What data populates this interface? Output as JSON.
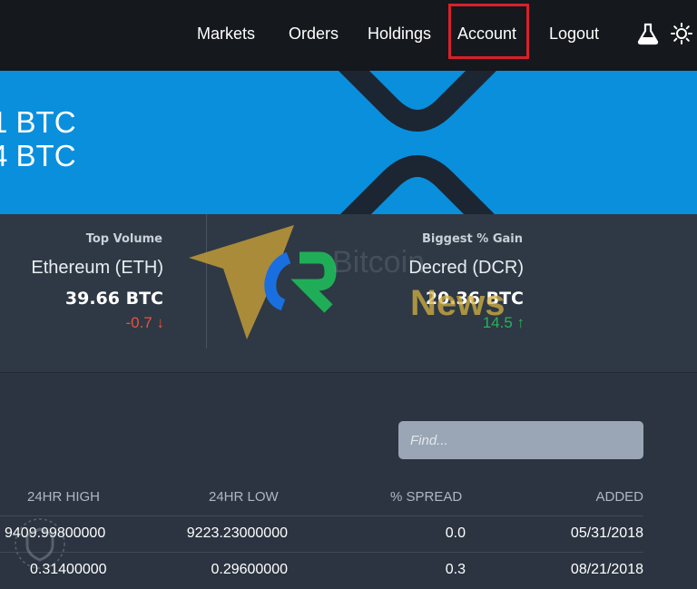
{
  "nav": {
    "items": [
      {
        "label": "Markets"
      },
      {
        "label": "Orders"
      },
      {
        "label": "Holdings"
      },
      {
        "label": "Account"
      },
      {
        "label": "Logout"
      }
    ],
    "icons": [
      "flask-icon",
      "sun-icon"
    ],
    "highlight_color": "#d8202a"
  },
  "banner": {
    "line1": "1 BTC",
    "line2": "4 BTC",
    "color": "#0a8fdc"
  },
  "stats": {
    "top_volume": {
      "label": "Top Volume",
      "name": "Ethereum (ETH)",
      "value": "39.66 BTC",
      "change": "-0.7 ↓"
    },
    "biggest_gain": {
      "label": "Biggest % Gain",
      "name": "Decred (DCR)",
      "value": "20.36 BTC",
      "change": "14.5 ↑"
    }
  },
  "watermark": {
    "text1": "Bitcoin",
    "text2": "News"
  },
  "market": {
    "search_placeholder": "Find...",
    "columns": [
      "24HR HIGH",
      "24HR LOW",
      "% SPREAD",
      "ADDED"
    ],
    "rows": [
      {
        "high": "9409.99800000",
        "low": "9223.23000000",
        "spread": "0.0",
        "added": "05/31/2018"
      },
      {
        "high": "0.31400000",
        "low": "0.29600000",
        "spread": "0.3",
        "added": "08/21/2018"
      }
    ]
  }
}
